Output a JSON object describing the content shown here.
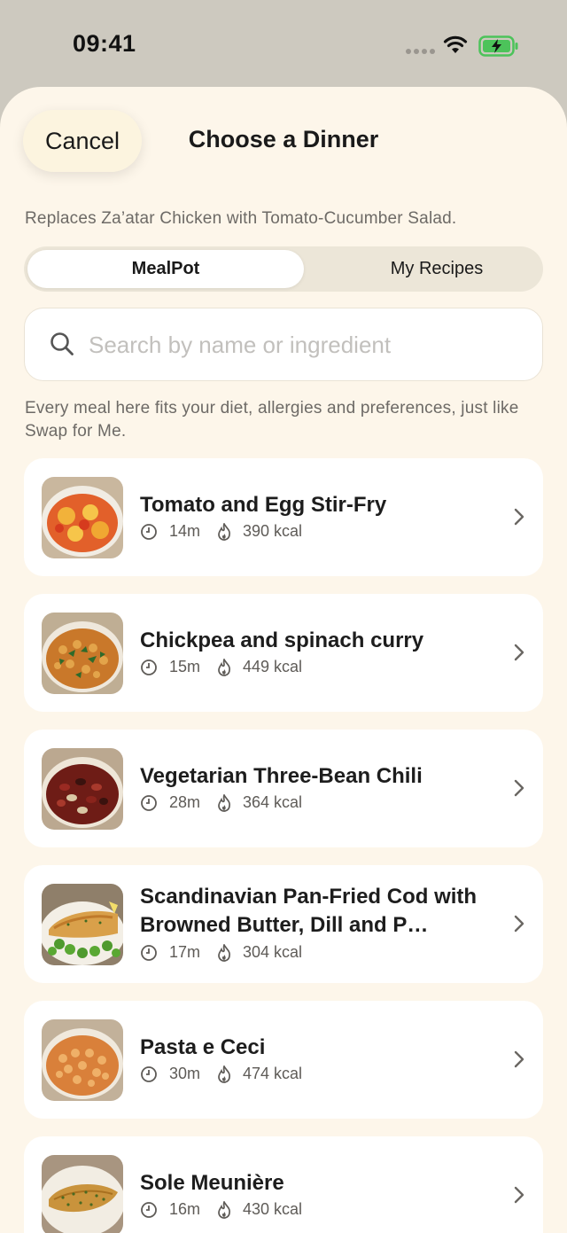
{
  "status_bar": {
    "time": "09:41"
  },
  "header": {
    "cancel_label": "Cancel",
    "title": "Choose a Dinner"
  },
  "subtitle": "Replaces Za’atar Chicken with Tomato-Cucumber Salad.",
  "tabs": [
    {
      "label": "MealPot",
      "selected": true
    },
    {
      "label": "My Recipes",
      "selected": false
    }
  ],
  "search": {
    "placeholder": "Search by name or ingredient",
    "value": ""
  },
  "note": "Every meal here fits your diet, allergies and preferences, just like Swap for Me.",
  "meals": [
    {
      "title": "Tomato and Egg Stir-Fry",
      "time": "14m",
      "kcal": "390 kcal",
      "image": "tomato-egg-stir-fry-photo"
    },
    {
      "title": "Chickpea and spinach curry",
      "time": "15m",
      "kcal": "449 kcal",
      "image": "chickpea-spinach-curry-photo"
    },
    {
      "title": "Vegetarian Three-Bean Chili",
      "time": "28m",
      "kcal": "364 kcal",
      "image": "three-bean-chili-photo"
    },
    {
      "title": "Scandinavian Pan-Fried Cod with Browned Butter, Dill and P…",
      "time": "17m",
      "kcal": "304 kcal",
      "image": "pan-fried-cod-photo"
    },
    {
      "title": "Pasta e Ceci",
      "time": "30m",
      "kcal": "474 kcal",
      "image": "pasta-e-ceci-photo"
    },
    {
      "title": "Sole Meunière",
      "time": "16m",
      "kcal": "430 kcal",
      "image": "sole-meuniere-photo"
    }
  ],
  "icons": {
    "search": "search-icon",
    "time": "clock-icon",
    "calories": "flame-icon",
    "row": "chevron-right-icon",
    "wifi": "wifi-icon",
    "battery": "battery-charging-icon"
  },
  "colors": {
    "sheet_background": "#fdf6ea",
    "card_background": "#ffffff",
    "battery_green": "#4cc35a"
  }
}
